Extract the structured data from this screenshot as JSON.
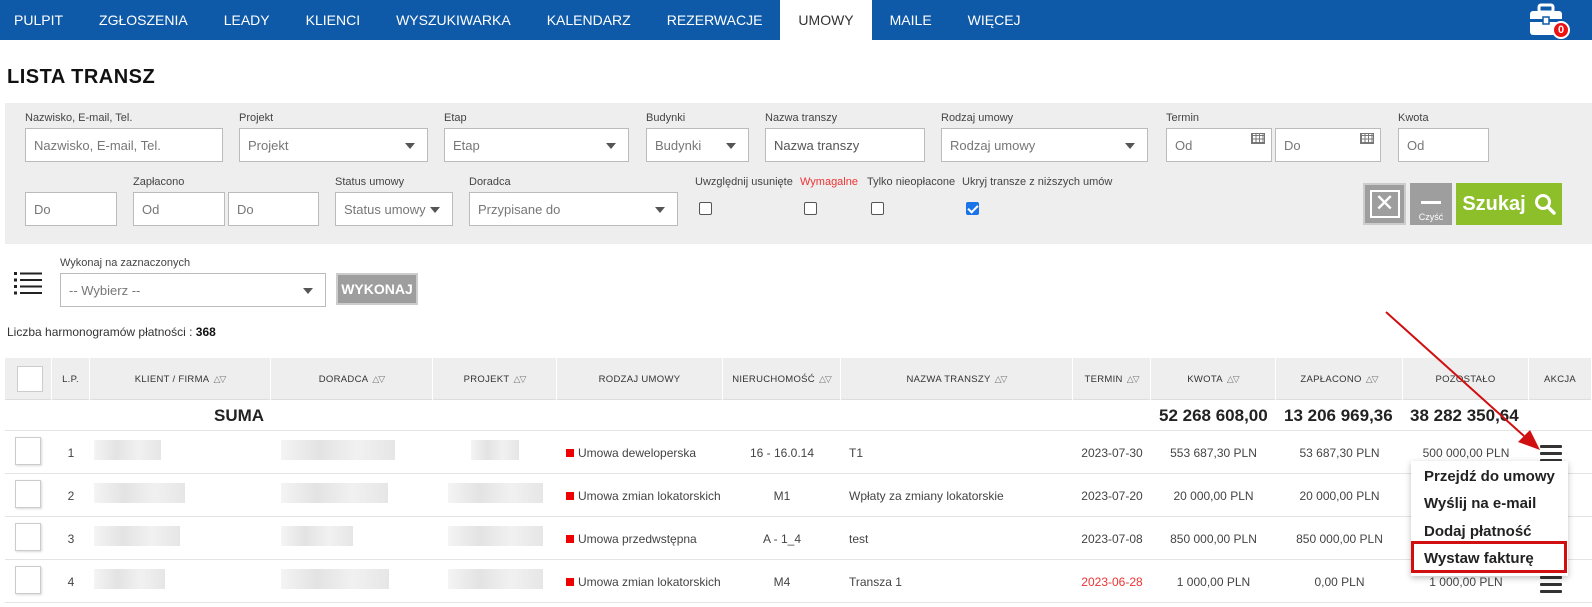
{
  "nav": {
    "items": [
      "PULPIT",
      "ZGŁOSZENIA",
      "LEADY",
      "KLIENCI",
      "WYSZUKIWARKA",
      "KALENDARZ",
      "REZERWACJE",
      "UMOWY",
      "MAILE",
      "WIĘCEJ"
    ],
    "active": "UMOWY",
    "badge": "0"
  },
  "page_title": "LISTA TRANSZ",
  "filters": {
    "contact_label": "Nazwisko, E-mail, Tel.",
    "contact_placeholder": "Nazwisko, E-mail, Tel.",
    "project_label": "Projekt",
    "project_value": "Projekt",
    "stage_label": "Etap",
    "stage_value": "Etap",
    "buildings_label": "Budynki",
    "buildings_value": "Budynki",
    "tranche_label": "Nazwa transzy",
    "tranche_placeholder": "Nazwa transzy",
    "contract_type_label": "Rodzaj umowy",
    "contract_type_value": "Rodzaj umowy",
    "term_label": "Termin",
    "term_from": "Od",
    "term_to": "Do",
    "amount_label": "Kwota",
    "amount_from": "Od",
    "amount_to": "Do",
    "paid_label": "Zapłacono",
    "paid_from": "Od",
    "paid_to": "Do",
    "status_label": "Status umowy",
    "status_value": "Status umowy",
    "advisor_label": "Doradca",
    "advisor_value": "Przypisane do",
    "include_deleted_label": "Uwzględnij usunięte",
    "due_label": "Wymagalne",
    "unpaid_label": "Tylko nieopłacone",
    "hide_lower_label": "Ukryj transze z niższych umów",
    "hide_lower_checked": true,
    "clear_label": "Czyść",
    "search_label": "Szukaj"
  },
  "bulk": {
    "label": "Wykonaj na zaznaczonych",
    "select_value": "-- Wybierz --",
    "execute_label": "WYKONAJ"
  },
  "count": {
    "label": "Liczba harmonogramów płatności :",
    "value": "368"
  },
  "table": {
    "headers": {
      "lp": "L.P.",
      "client": "KLIENT / FIRMA",
      "advisor": "DORADCA",
      "project": "PROJEKT",
      "contract_type": "RODZAJ UMOWY",
      "property": "NIERUCHOMOŚĆ",
      "tranche": "NAZWA TRANSZY",
      "term": "TERMIN",
      "amount": "KWOTA",
      "paid": "ZAPŁACONO",
      "remaining": "POZOSTAŁO",
      "action": "AKCJA"
    },
    "sum": {
      "label": "SUMA",
      "amount": "52 268 608,00",
      "paid": "13 206 969,36",
      "remaining": "38 282 350,64"
    },
    "rows": [
      {
        "lp": "1",
        "contract_type": "Umowa deweloperska",
        "property": "16 - 16.0.14",
        "tranche": "T1",
        "term": "2023-07-30",
        "amount": "553 687,30 PLN",
        "paid": "53 687,30 PLN",
        "remaining": "500 000,00 PLN"
      },
      {
        "lp": "2",
        "contract_type": "Umowa zmian lokatorskich",
        "property": "M1",
        "tranche": "Wpłaty za zmiany lokatorskie",
        "term": "2023-07-20",
        "amount": "20 000,00 PLN",
        "paid": "20 000,00 PLN",
        "remaining": ""
      },
      {
        "lp": "3",
        "contract_type": "Umowa przedwstępna",
        "property": "A - 1_4",
        "tranche": "test",
        "term": "2023-07-08",
        "amount": "850 000,00 PLN",
        "paid": "850 000,00 PLN",
        "remaining": ""
      },
      {
        "lp": "4",
        "contract_type": "Umowa zmian lokatorskich",
        "property": "M4",
        "tranche": "Transza 1",
        "term": "2023-06-28",
        "amount": "1 000,00 PLN",
        "paid": "0,00 PLN",
        "remaining": "1 000,00 PLN"
      }
    ]
  },
  "context_menu": {
    "items": [
      "Przejdź do umowy",
      "Wyślij na e-mail",
      "Dodaj płatność",
      "Wystaw fakturę"
    ]
  },
  "colors": {
    "nav_bg": "#0f5aa8",
    "search_green": "#8cbf2a",
    "highlight_red": "#d01010",
    "overdue_red": "#e33333"
  }
}
